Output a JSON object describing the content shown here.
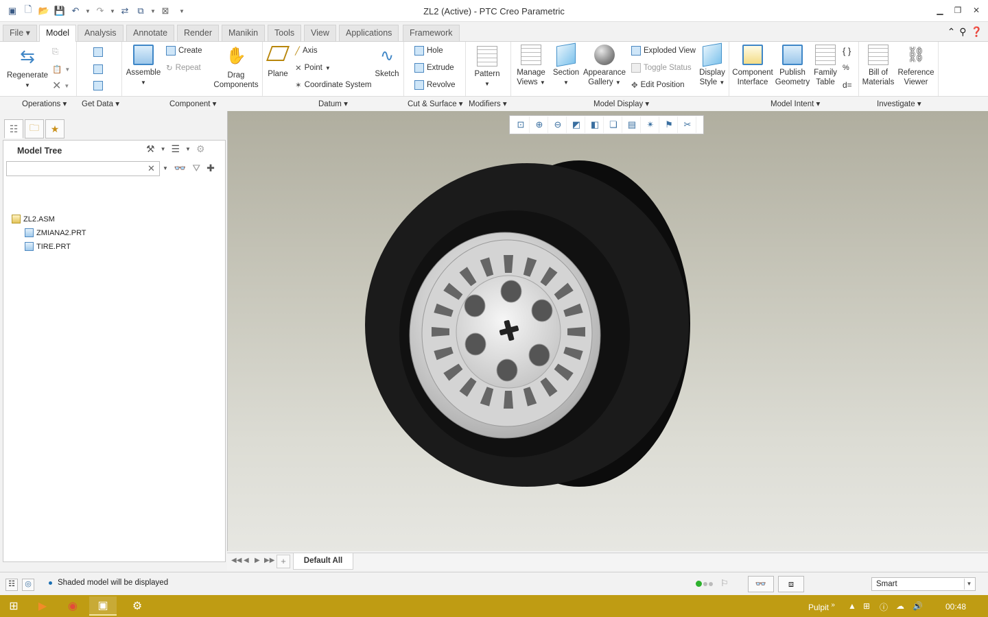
{
  "window": {
    "title": "ZL2 (Active) - PTC Creo Parametric",
    "controls": [
      "minimize-icon",
      "restore-icon",
      "close-icon"
    ]
  },
  "tabs": [
    "File",
    "Model",
    "Analysis",
    "Annotate",
    "Render",
    "Manikin",
    "Tools",
    "View",
    "Applications",
    "Framework"
  ],
  "active_tab": "Model",
  "ribbon": {
    "regenerate": "Regenerate",
    "assemble": "Assemble",
    "create": "Create",
    "repeat": "Repeat",
    "drag_line1": "Drag",
    "drag_line2": "Components",
    "plane": "Plane",
    "axis": "Axis",
    "point": "Point",
    "coordinate_system": "Coordinate System",
    "sketch": "Sketch",
    "hole": "Hole",
    "extrude": "Extrude",
    "revolve": "Revolve",
    "pattern": "Pattern",
    "manage_line1": "Manage",
    "manage_line2": "Views",
    "section": "Section",
    "appearance_line1": "Appearance",
    "appearance_line2": "Gallery",
    "exploded_view": "Exploded View",
    "toggle_status": "Toggle Status",
    "edit_position": "Edit Position",
    "display_line1": "Display",
    "display_line2": "Style",
    "component_line1": "Component",
    "component_line2": "Interface",
    "publish_line1": "Publish",
    "publish_line2": "Geometry",
    "family_line1": "Family",
    "family_line2": "Table",
    "bom_line1": "Bill of",
    "bom_line2": "Materials",
    "refviewer_line1": "Reference",
    "refviewer_line2": "Viewer"
  },
  "groups": {
    "operations": "Operations",
    "get_data": "Get Data",
    "component": "Component",
    "datum": "Datum",
    "cut_surface": "Cut & Surface",
    "modifiers": "Modifiers",
    "model_display": "Model Display",
    "model_intent": "Model Intent",
    "investigate": "Investigate"
  },
  "model_tree": {
    "header": "Model Tree",
    "search_placeholder": "",
    "items": [
      {
        "name": "ZL2.ASM",
        "type": "assembly"
      },
      {
        "name": "ZMIANA2.PRT",
        "type": "part"
      },
      {
        "name": "TIRE.PRT",
        "type": "part"
      }
    ]
  },
  "view_tabs": {
    "current": "Default All"
  },
  "status": {
    "message": "Shaded model will be displayed",
    "selection_filter": "Smart"
  },
  "taskbar": {
    "pulpit": "Pulpit",
    "clock": "00:48"
  }
}
